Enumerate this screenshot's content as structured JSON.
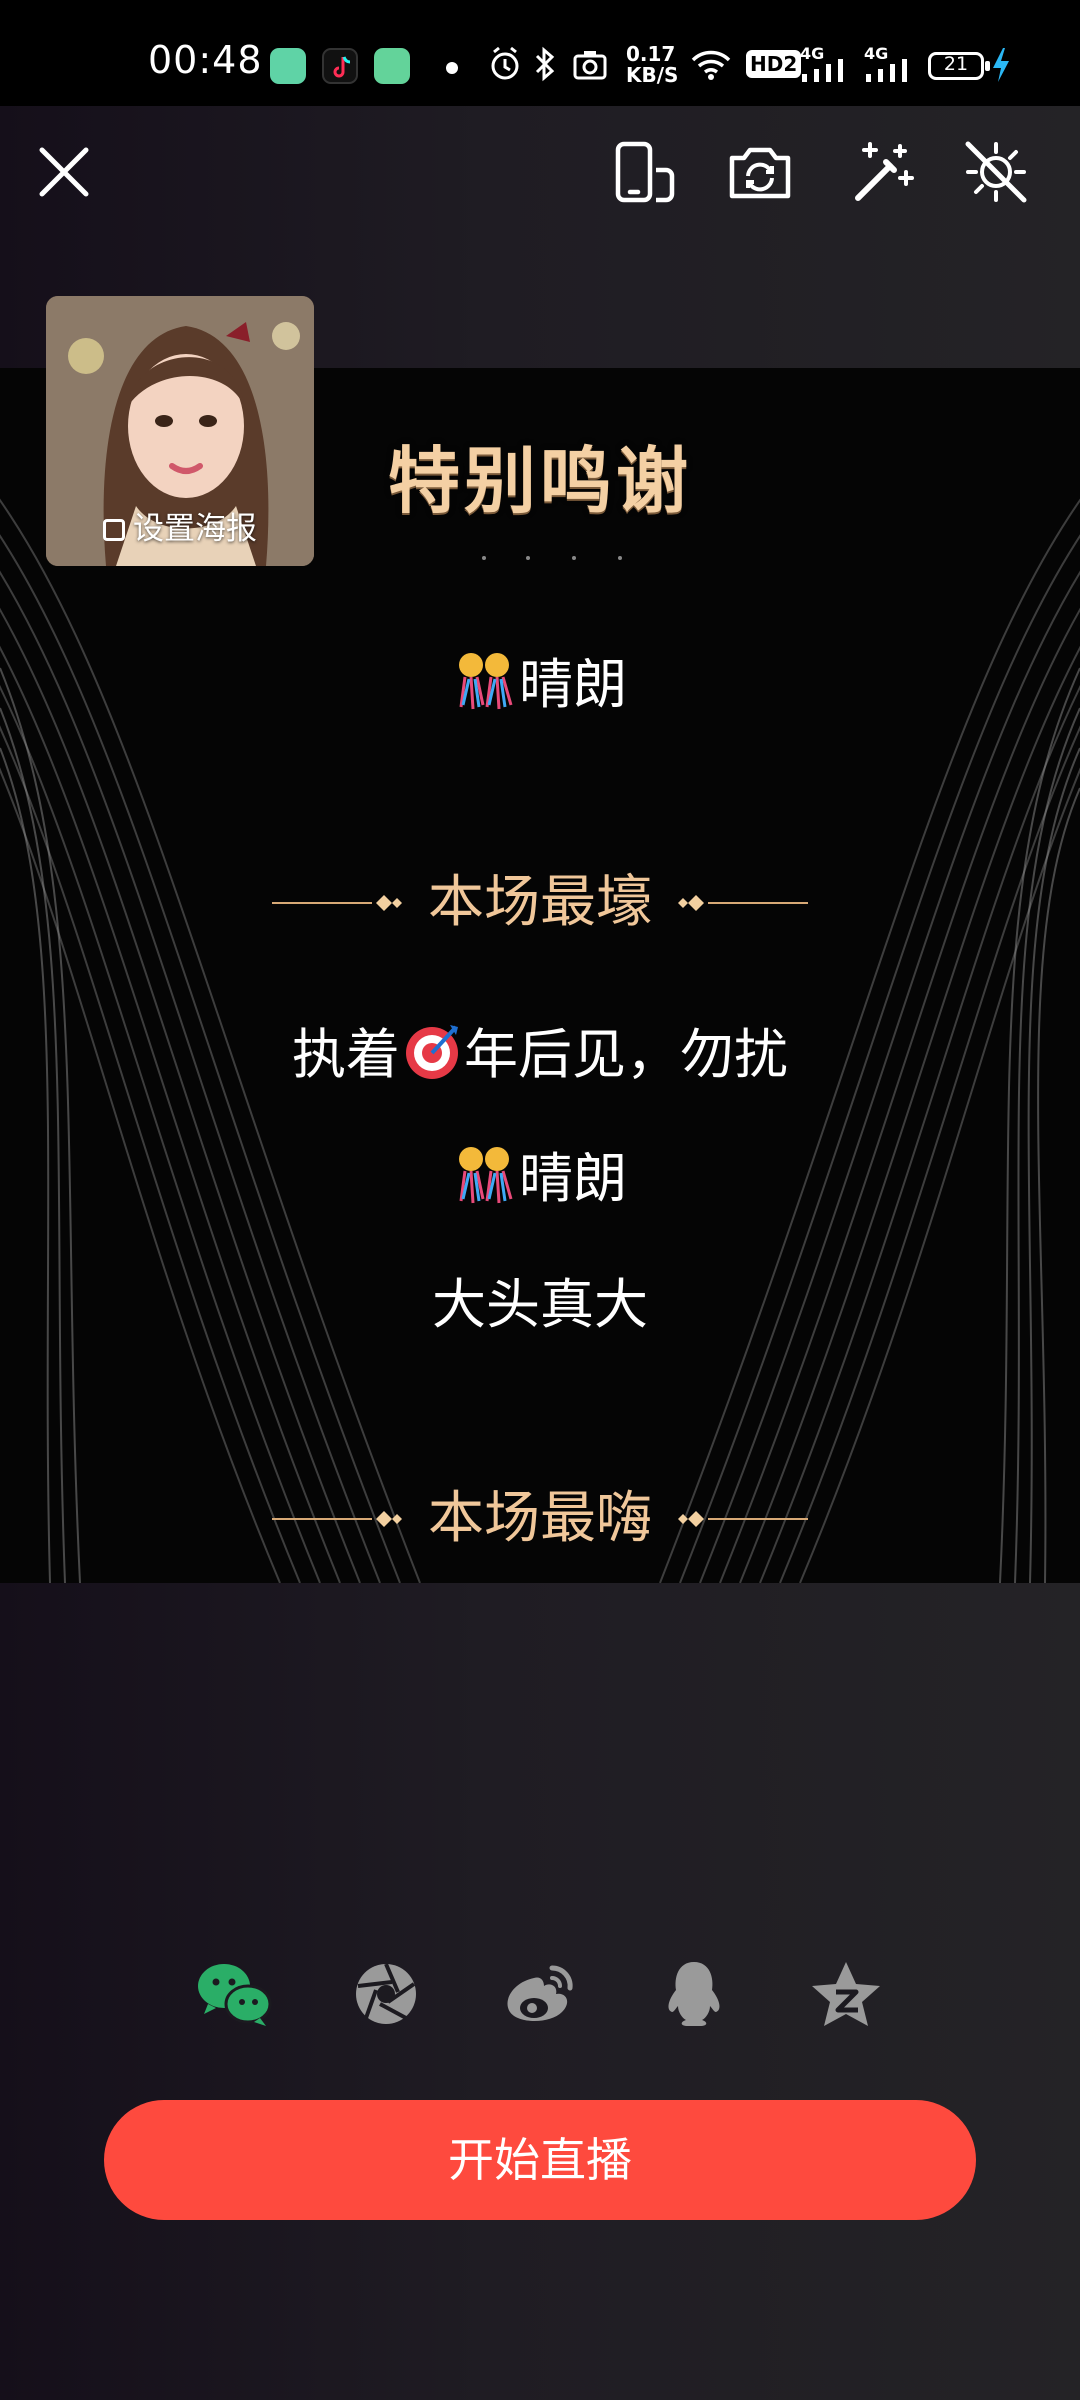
{
  "status_bar": {
    "time": "00:48",
    "speed_value": "0.17",
    "speed_unit": "KB/S",
    "hd_label": "HD2",
    "network_1": "4G",
    "network_2": "4G",
    "battery_level": "21",
    "icons": [
      "app-icon-green",
      "tiktok-icon",
      "app-icon-green-2",
      "notification-dot",
      "alarm-icon",
      "bluetooth-icon",
      "camera-icon",
      "wifi-icon",
      "signal-icon",
      "signal-icon",
      "battery-icon",
      "charging-icon"
    ]
  },
  "toolbar": {
    "icons": [
      "close-icon",
      "screen-orientation-icon",
      "flip-camera-icon",
      "beauty-magic-icon",
      "effects-off-icon"
    ]
  },
  "cover": {
    "label": "设置海报"
  },
  "poster": {
    "title": "特别鸣谢",
    "thanks_name": "晴朗",
    "section_1": "本场最壕",
    "section_1_names": [
      "执着",
      "年后见，勿扰",
      "晴朗",
      "大头真大"
    ],
    "section_2": "本场最嗨"
  },
  "share": {
    "icons": [
      "wechat-icon",
      "moments-icon",
      "weibo-icon",
      "qq-icon",
      "qzone-icon"
    ],
    "wechat_color": "#2aae67",
    "default_color": "#9a9a9a"
  },
  "start_button": {
    "label": "开始直播",
    "color": "#fe4a3e"
  }
}
